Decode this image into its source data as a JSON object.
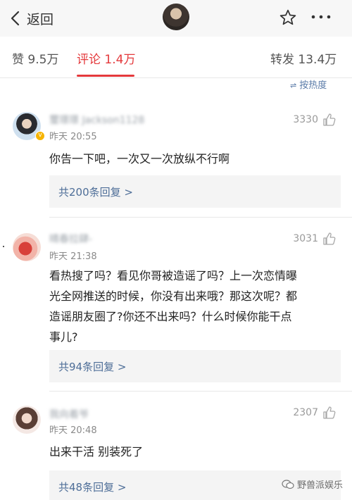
{
  "nav": {
    "back_label": "返回",
    "icons": [
      "chevron-left-icon",
      "star-icon",
      "more-icon"
    ]
  },
  "tabs": {
    "likes": "赞 9.5万",
    "comments": "评论 1.4万",
    "reposts": "转发 13.4万",
    "sort_label": "按热度",
    "accent_color": "#e4393c"
  },
  "comments": [
    {
      "username": "璽璟璟 Jackson1128",
      "time": "昨天 20:55",
      "likes": "3330",
      "text": "你告一下吧，一次又一次放纵不行啊",
      "replies": "共200条回复 >",
      "verified": true
    },
    {
      "username": "晴春拉肆-",
      "time": "昨天 21:38",
      "likes": "3031",
      "text_lines": [
        "看热搜了吗？看见你哥被造谣了吗？上一次恋情曝",
        "光全网推送的时候，你没有出来哦？那这次呢？都",
        "造谣朋友圈了?你还不出来吗？什么时候你能干点",
        "事儿?"
      ],
      "replies": "共94条回复 >"
    },
    {
      "username": "我向着爷",
      "time": "昨天 20:48",
      "likes": "2307",
      "text": "出来干活 别装死了",
      "replies": "共48条回复 >"
    }
  ],
  "watermark": "野兽派娱乐",
  "colors": {
    "link": "#4e6e98",
    "reply_bg": "#f4f4f4",
    "nav_bg": "#f7f7f7"
  }
}
